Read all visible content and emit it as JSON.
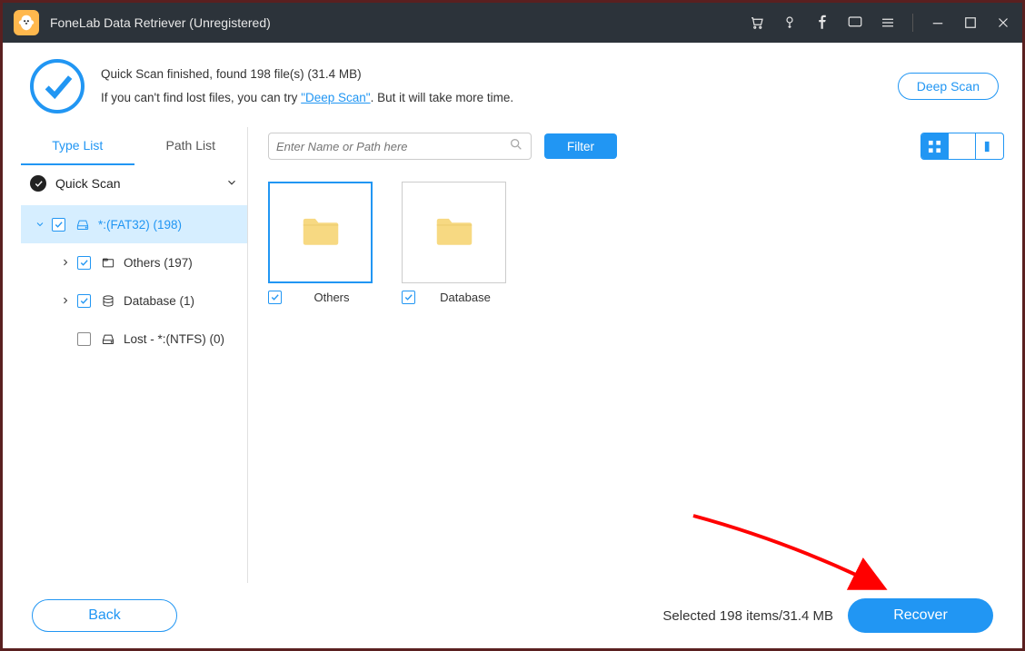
{
  "titlebar": {
    "title": "FoneLab Data Retriever (Unregistered)"
  },
  "header": {
    "line1": "Quick Scan finished, found 198 file(s) (31.4 MB)",
    "line2a": "If you can't find lost files, you can try ",
    "deep_link": "\"Deep Scan\"",
    "line2b": ". But it will take more time.",
    "deep_scan_btn": "Deep Scan"
  },
  "side_tabs": {
    "type_list": "Type List",
    "path_list": "Path List"
  },
  "section_head": "Quick Scan",
  "tree": {
    "n0": "*:(FAT32) (198)",
    "n1": "Others (197)",
    "n2": "Database (1)",
    "n3": "Lost - *:(NTFS) (0)"
  },
  "search": {
    "placeholder": "Enter Name or Path here"
  },
  "filter_btn": "Filter",
  "tiles": {
    "t0": "Others",
    "t1": "Database"
  },
  "footer": {
    "back": "Back",
    "selected": "Selected 198 items/31.4 MB",
    "recover": "Recover"
  }
}
